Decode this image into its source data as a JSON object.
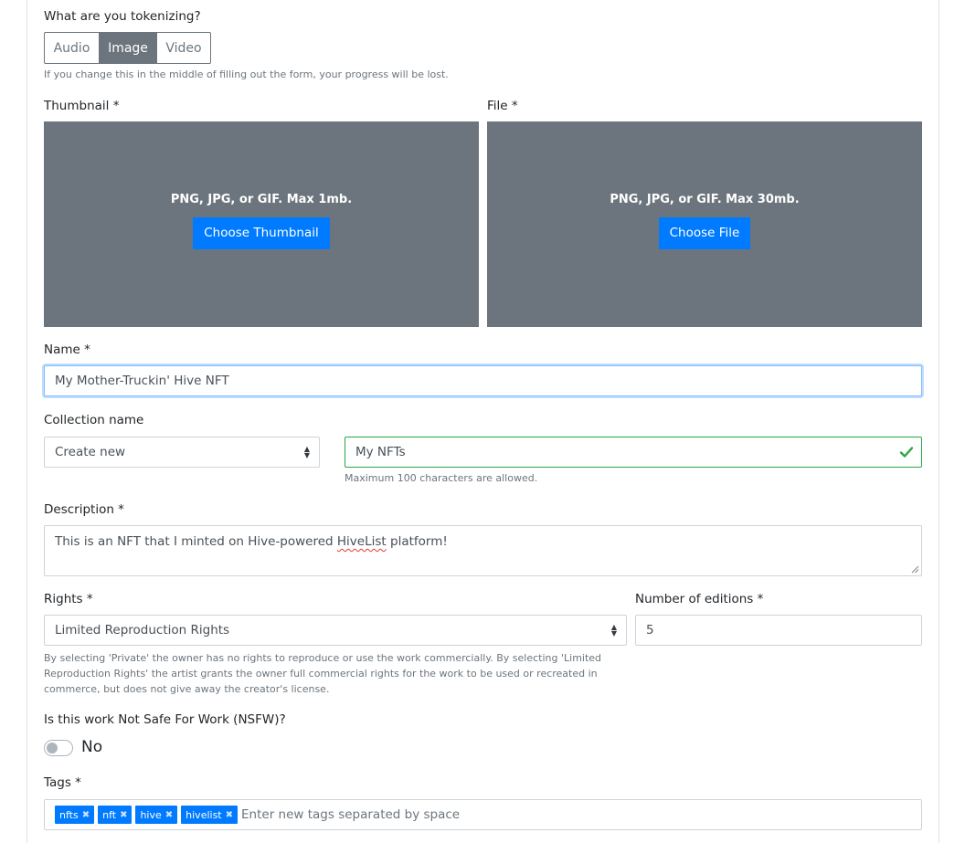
{
  "tokenize": {
    "label": "What are you tokenizing?",
    "options": [
      "Audio",
      "Image",
      "Video"
    ],
    "selected": "Image",
    "help": "If you change this in the middle of filling out the form, your progress will be lost."
  },
  "thumbnail": {
    "label": "Thumbnail *",
    "hint": "PNG, JPG, or GIF. Max 1mb.",
    "button": "Choose Thumbnail"
  },
  "file": {
    "label": "File *",
    "hint": "PNG, JPG, or GIF. Max 30mb.",
    "button": "Choose File"
  },
  "name": {
    "label": "Name *",
    "value": "My Mother-Truckin' Hive NFT"
  },
  "collection": {
    "label": "Collection name",
    "select_value": "Create new",
    "input_value": "My NFTs",
    "help": "Maximum 100 characters are allowed."
  },
  "description": {
    "label": "Description *",
    "value_before": "This is an NFT that I minted on Hive-powered ",
    "value_misspelled": "HiveList",
    "value_after": " platform!"
  },
  "rights": {
    "label": "Rights *",
    "value": "Limited Reproduction Rights",
    "help": "By selecting 'Private' the owner has no rights to reproduce or use the work commercially. By selecting 'Limited Reproduction Rights' the artist grants the owner full commercial rights for the work to be used or recreated in commerce, but does not give away the creator's license."
  },
  "editions": {
    "label": "Number of editions *",
    "value": "5"
  },
  "nsfw": {
    "label": "Is this work Not Safe For Work (NSFW)?",
    "state": "No"
  },
  "tags": {
    "label": "Tags *",
    "items": [
      "nfts",
      "nft",
      "hive",
      "hivelist"
    ],
    "placeholder": "Enter new tags separated by space"
  },
  "colors": {
    "primary": "#007bff",
    "secondary": "#6c757d",
    "success": "#28a745",
    "focus": "#80bdff"
  }
}
